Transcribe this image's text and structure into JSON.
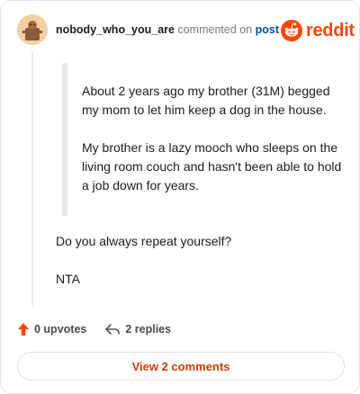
{
  "comment": {
    "username": "nobody_who_you_are",
    "action_text": "commented on",
    "post_link_text": "post",
    "quote_paragraphs": [
      "About 2 years ago my brother (31M) begged my mom to let him keep a dog in the house.",
      "My brother is a lazy mooch who sleeps on the living room couch and hasn't been able to hold a job down for years."
    ],
    "reply_paragraphs": [
      "Do you always repeat yourself?",
      "NTA"
    ]
  },
  "brand": {
    "wordmark": "reddit",
    "color": "#ff4500"
  },
  "actions": {
    "upvotes_label": "0 upvotes",
    "replies_label": "2 replies",
    "upvote_icon": "arrow-up-icon",
    "reply_icon": "reply-arrow-icon",
    "upvote_color": "#ff4500"
  },
  "footer": {
    "view_comments_label": "View 2 comments",
    "button_text_color": "#d93a00"
  }
}
